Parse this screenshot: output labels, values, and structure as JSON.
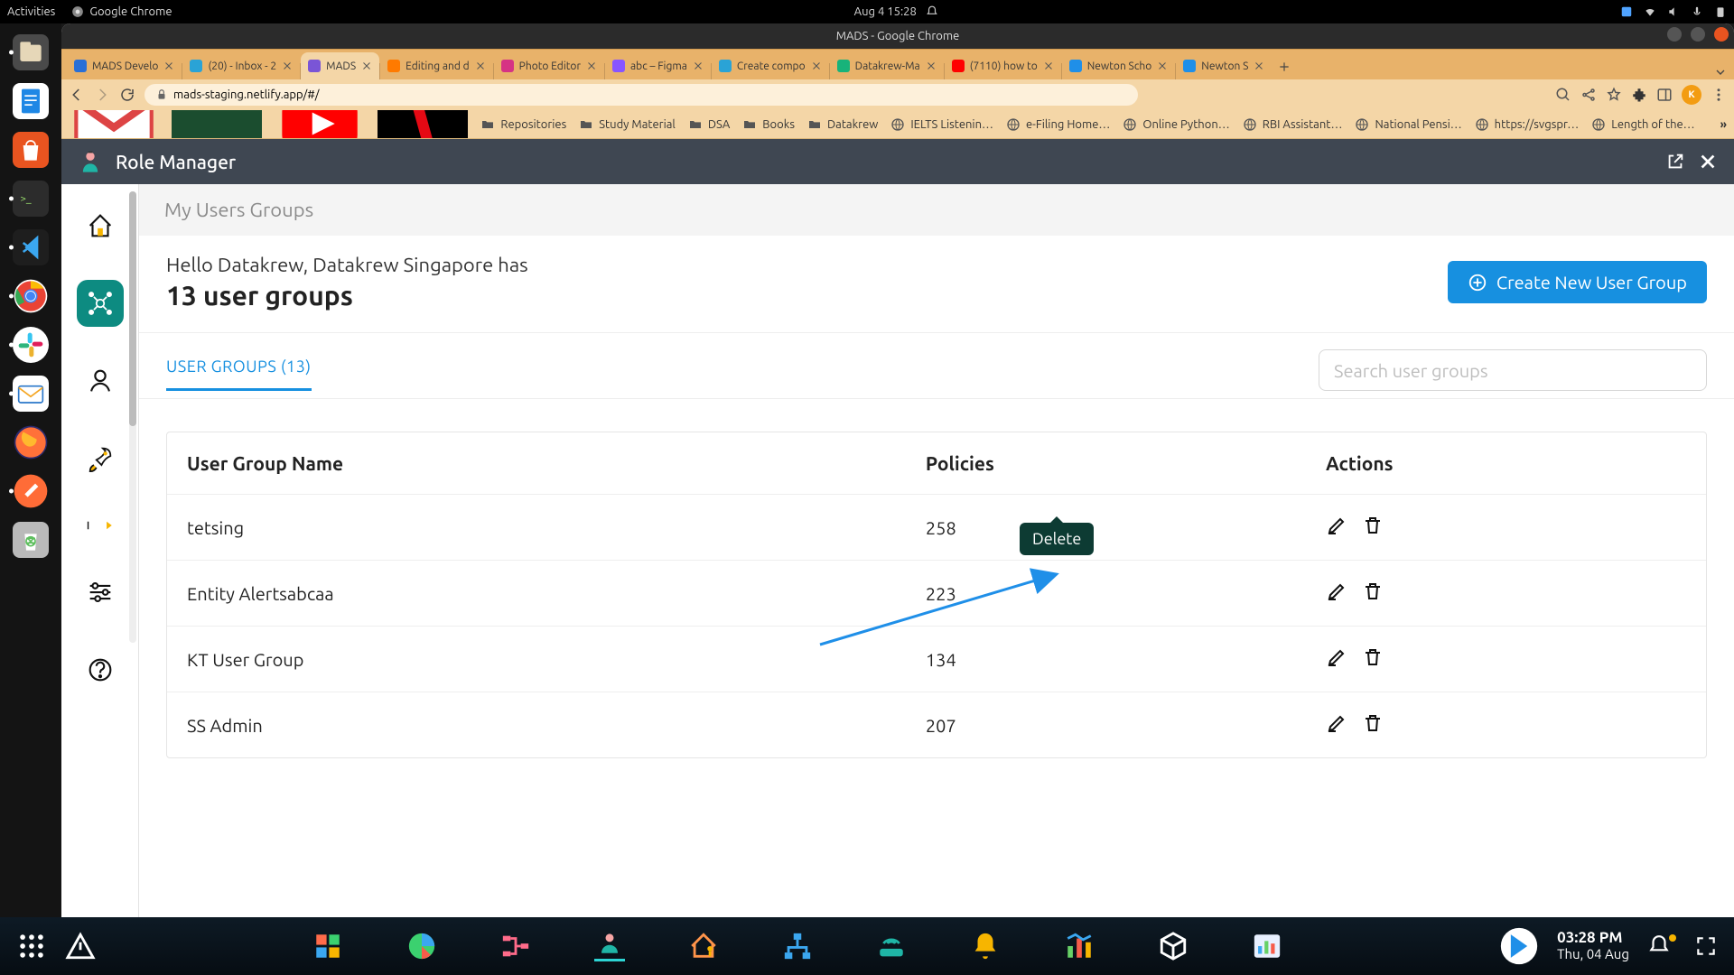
{
  "os_top": {
    "activities": "Activities",
    "app_label": "Google Chrome",
    "clock": "Aug 4  15:28"
  },
  "chrome": {
    "title": "MADS - Google Chrome",
    "url": "mads-staging.netlify.app/#/",
    "avatar_letter": "K",
    "tabs": [
      {
        "label": "MADS Develo"
      },
      {
        "label": "(20) - Inbox - 2"
      },
      {
        "label": "MADS",
        "active": true
      },
      {
        "label": "Editing and d"
      },
      {
        "label": "Photo Editor"
      },
      {
        "label": "abc – Figma"
      },
      {
        "label": "Create compo"
      },
      {
        "label": "Datakrew-Ma"
      },
      {
        "label": "(7110) how to"
      },
      {
        "label": "Newton Scho"
      },
      {
        "label": "Newton S"
      }
    ],
    "bookmarks": [
      {
        "label": "Repositories",
        "kind": "folder"
      },
      {
        "label": "Study Material",
        "kind": "folder"
      },
      {
        "label": "DSA",
        "kind": "folder"
      },
      {
        "label": "Books",
        "kind": "folder"
      },
      {
        "label": "Datakrew",
        "kind": "folder"
      },
      {
        "label": "IELTS Listenin…",
        "kind": "site"
      },
      {
        "label": "e-Filing Home…",
        "kind": "site"
      },
      {
        "label": "Online Python…",
        "kind": "site"
      },
      {
        "label": "RBI Assistant…",
        "kind": "site"
      },
      {
        "label": "National Pensi…",
        "kind": "site"
      },
      {
        "label": "https://svgspr…",
        "kind": "site"
      },
      {
        "label": "Length of the…",
        "kind": "site"
      }
    ]
  },
  "app": {
    "header_title": "Role Manager",
    "band_title": "My Users Groups",
    "hello_line1": "Hello Datakrew, Datakrew Singapore has",
    "hello_line2": "13 user groups",
    "create_btn": "Create New User Group",
    "tab_label": "USER GROUPS (13)",
    "search_placeholder": "Search user groups",
    "columns": {
      "name": "User Group Name",
      "policies": "Policies",
      "actions": "Actions"
    },
    "rows": [
      {
        "name": "tetsing",
        "policies": "258"
      },
      {
        "name": "Entity Alertsabcaa",
        "policies": "223"
      },
      {
        "name": "KT User Group",
        "policies": "134"
      },
      {
        "name": "SS Admin",
        "policies": "207"
      }
    ],
    "tooltip_delete": "Delete"
  },
  "bottom": {
    "time": "03:28 PM",
    "date": "Thu, 04 Aug"
  }
}
